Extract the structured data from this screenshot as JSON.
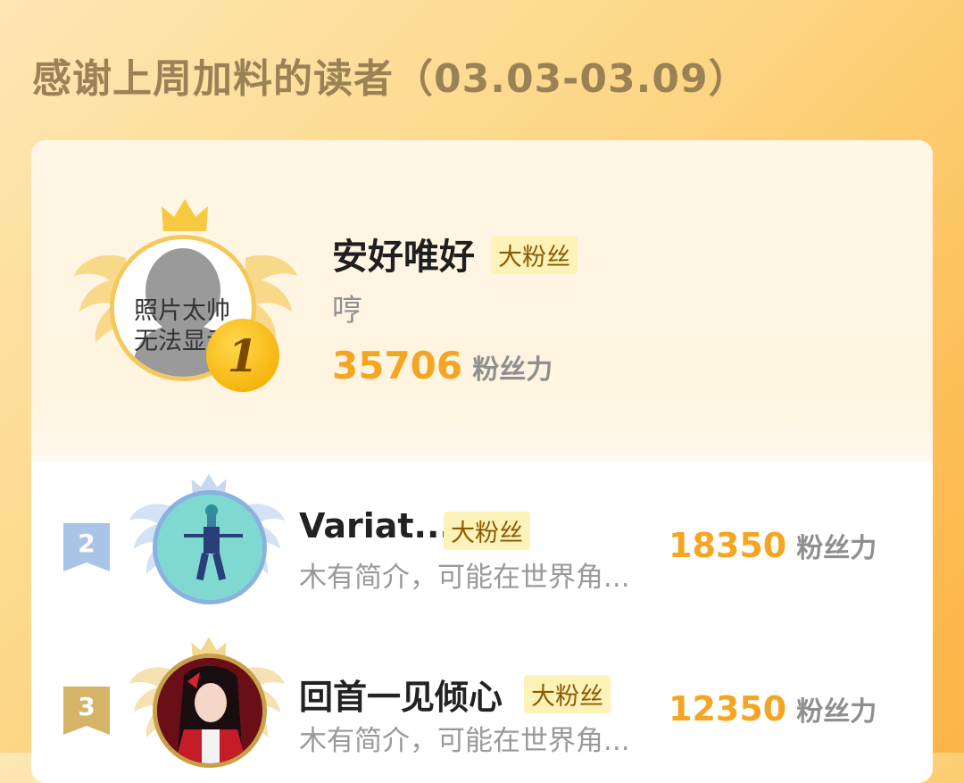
{
  "header": {
    "title": "感谢上周加料的读者（03.03-03.09）"
  },
  "top_reader": {
    "rank": "1",
    "name": "安好唯好",
    "tag": "大粉丝",
    "intro": "哼",
    "avatar_placeholder": "照片太帅\n无法显示",
    "score": "35706",
    "score_unit": "粉丝力"
  },
  "readers": [
    {
      "rank": "2",
      "name": "Variat...",
      "tag": "大粉丝",
      "intro": "木有简介，可能在世界角...",
      "score": "18350",
      "score_unit": "粉丝力"
    },
    {
      "rank": "3",
      "name": "回首一见倾心",
      "tag": "大粉丝",
      "intro": "木有简介，可能在世界角...",
      "score": "12350",
      "score_unit": "粉丝力"
    }
  ],
  "colors": {
    "accent": "#f4a521",
    "tag_bg": "#fdf2b8",
    "title": "#9b8256"
  }
}
